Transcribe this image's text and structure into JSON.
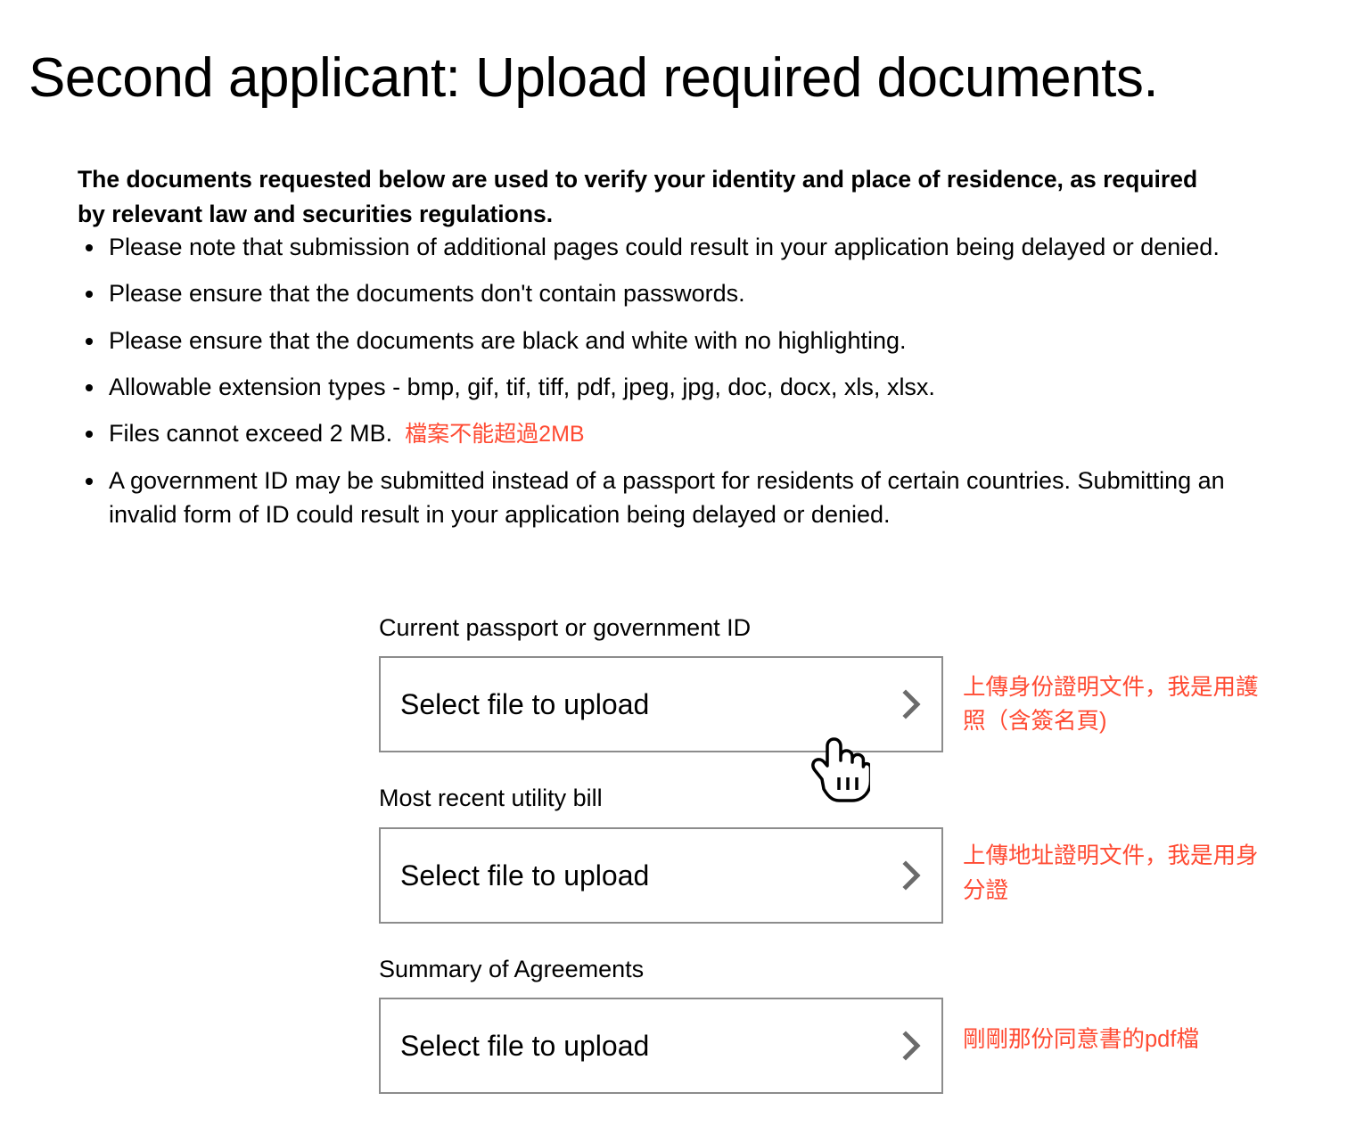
{
  "page": {
    "title": "Second applicant: Upload required documents.",
    "intro": "The documents requested below are used to verify your identity and place of residence, as required by relevant law and securities regulations."
  },
  "bullets": [
    {
      "text": "Please note that submission of additional pages could result in your application being delayed or denied.",
      "note": ""
    },
    {
      "text": "Please ensure that the documents don't contain passwords.",
      "note": ""
    },
    {
      "text": "Please ensure that the documents are black and white with no highlighting.",
      "note": ""
    },
    {
      "text": "Allowable extension types - bmp, gif, tif, tiff, pdf, jpeg, jpg, doc, docx, xls, xlsx.",
      "note": ""
    },
    {
      "text": "Files cannot exceed 2 MB.",
      "note": "檔案不能超過2MB"
    },
    {
      "text": "A government ID may be submitted instead of a passport for residents of certain countries. Submitting an invalid form of ID could result in your application being delayed or denied.",
      "note": ""
    }
  ],
  "uploads": [
    {
      "label": "Current passport or government ID",
      "button_text": "Select file to upload",
      "chevron": "chevron-right-icon",
      "annotation": "上傳身份證明文件，我是用護照（含簽名頁)"
    },
    {
      "label": "Most recent utility bill",
      "button_text": "Select file to upload",
      "chevron": "chevron-right-icon",
      "annotation": "上傳地址證明文件，我是用身分證"
    },
    {
      "label": "Summary of Agreements",
      "button_text": "Select file to upload",
      "chevron": "chevron-right-icon",
      "annotation": "剛剛那份同意書的pdf檔"
    }
  ],
  "cursor": {
    "type": "pointing-hand-cursor"
  },
  "colors": {
    "annotation_red": "#FF4B33",
    "box_border_gray": "#8c8c8c",
    "chevron_gray": "#6b6b6b",
    "text_black": "#000000",
    "background": "#ffffff"
  }
}
